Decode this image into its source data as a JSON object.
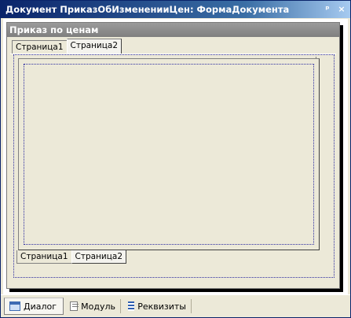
{
  "window": {
    "title": "Документ ПриказОбИзмененииЦен: ФормаДокумента",
    "buttons": {
      "pin": "ᵖ",
      "close": "×"
    }
  },
  "form": {
    "title": "Приказ по ценам",
    "top_tabs": [
      {
        "label": "Страница1",
        "active": false
      },
      {
        "label": "Страница2",
        "active": true
      }
    ],
    "bottom_tabs": [
      {
        "label": "Страница1",
        "active": false
      },
      {
        "label": "Страница2",
        "active": true
      }
    ]
  },
  "bottom_strip": {
    "tabs": [
      {
        "label": "Диалог",
        "icon": "dialog-icon",
        "active": true
      },
      {
        "label": "Модуль",
        "icon": "module-icon",
        "active": false
      },
      {
        "label": "Реквизиты",
        "icon": "props-icon",
        "active": false
      }
    ]
  }
}
